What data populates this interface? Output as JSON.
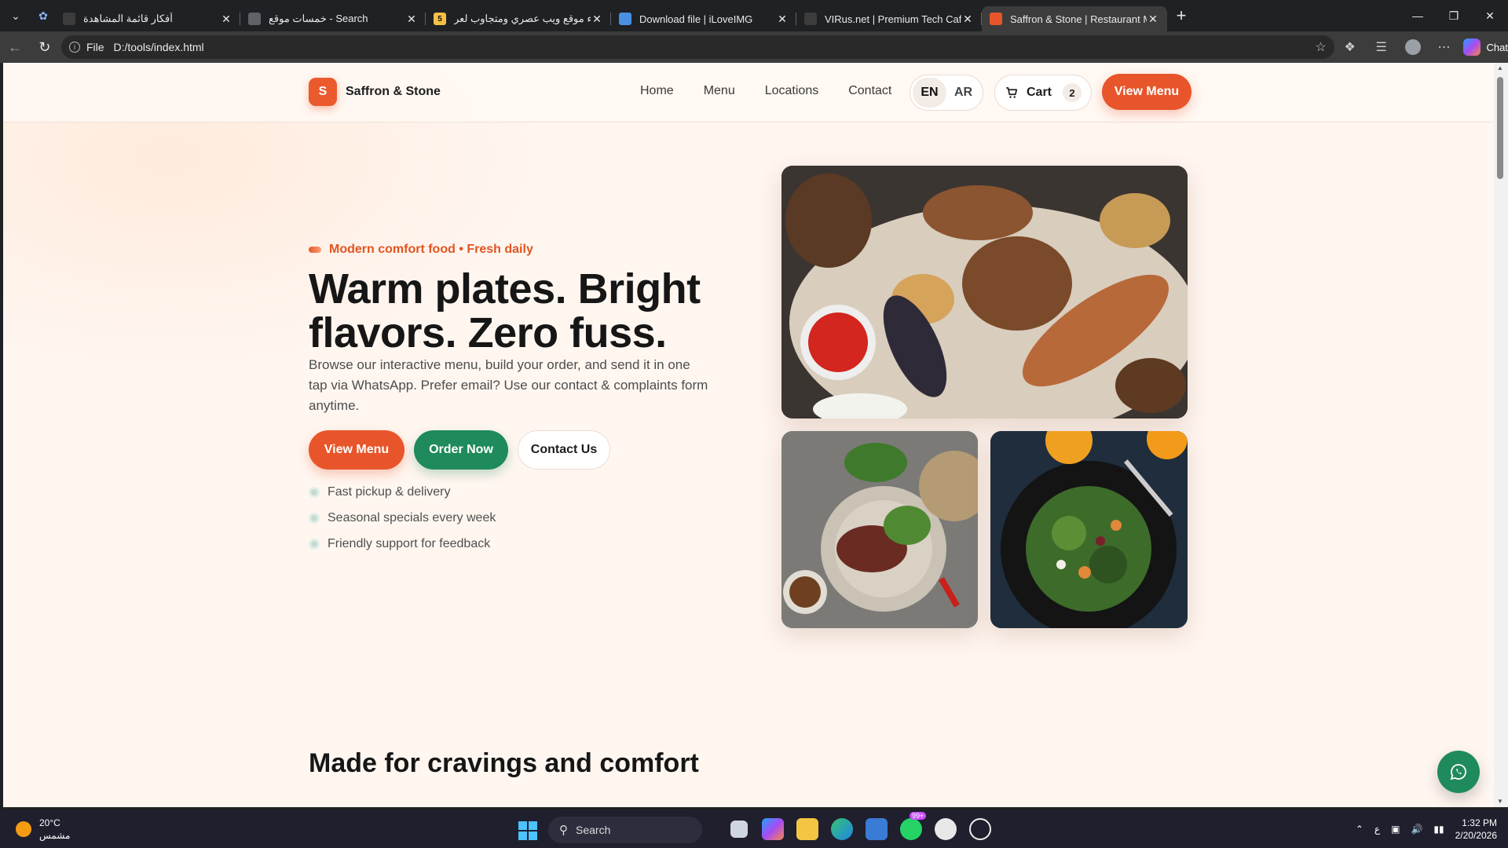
{
  "browser": {
    "tabs": [
      {
        "title": "أفكار قائمة المشاهدة",
        "favicon_color": "#3c3c3c",
        "active": false
      },
      {
        "title": "خمسات موقع - Search",
        "favicon_color": "#5f6368",
        "active": false
      },
      {
        "title": "إنشاء موقع ويب عصري ومتجاوب لعر",
        "favicon_color": "#f6c046",
        "favicon_letter": "5",
        "active": false
      },
      {
        "title": "Download file | iLoveIMG",
        "favicon_color": "#4a90e2",
        "active": false
      },
      {
        "title": "VIRus.net | Premium Tech Cafe",
        "favicon_color": "#3c3c3c",
        "active": false
      },
      {
        "title": "Saffron & Stone | Restaurant Menu",
        "favicon_color": "#e8552a",
        "active": true
      }
    ],
    "address": {
      "scheme": "File",
      "url": "D:/tools/index.html"
    },
    "chat_label": "Chat"
  },
  "site": {
    "brand": {
      "logo_letter": "S",
      "name": "Saffron & Stone"
    },
    "nav": [
      "Home",
      "Menu",
      "Locations",
      "Contact"
    ],
    "lang": {
      "en": "EN",
      "ar": "AR",
      "selected": "EN"
    },
    "cart": {
      "label": "Cart",
      "count": "2"
    },
    "header_cta": "View Menu",
    "hero": {
      "eyebrow": "Modern comfort food • Fresh daily",
      "title": "Warm plates. Bright flavors. Zero fuss.",
      "subtitle": "Browse our interactive menu, build your order, and send it in one tap via WhatsApp. Prefer email? Use our contact & complaints form anytime.",
      "buttons": {
        "view_menu": "View Menu",
        "order_now": "Order Now",
        "contact_us": "Contact Us"
      },
      "bullets": [
        "Fast pickup & delivery",
        "Seasonal specials every week",
        "Friendly support for feedback"
      ]
    },
    "section_title": "Made for cravings and comfort",
    "colors": {
      "accent": "#e8552a",
      "green": "#1f8a5b",
      "background": "#fff6f0"
    }
  },
  "taskbar": {
    "weather": {
      "temp": "20°C",
      "condition": "مشمس"
    },
    "search_label": "Search",
    "notification_badge": "99+",
    "ime": "ع",
    "time": "1:32 PM",
    "date": "2/20/2026"
  }
}
